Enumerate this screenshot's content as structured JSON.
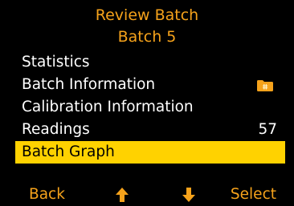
{
  "header": {
    "title": "Review Batch",
    "subtitle": "Batch 5"
  },
  "menu": {
    "items": [
      {
        "label": "Statistics"
      },
      {
        "label": "Batch Information",
        "icon": "folder-icon"
      },
      {
        "label": "Calibration Information"
      },
      {
        "label": "Readings",
        "value": "57"
      },
      {
        "label": "Batch Graph",
        "selected": true
      }
    ]
  },
  "softkeys": {
    "back": "Back",
    "up_icon": "arrow-up-icon",
    "down_icon": "arrow-down-icon",
    "select": "Select"
  },
  "colors": {
    "background": "#000000",
    "accent_orange": "#f5a21b",
    "selection_yellow": "#ffd200",
    "text_white": "#ffffff"
  }
}
